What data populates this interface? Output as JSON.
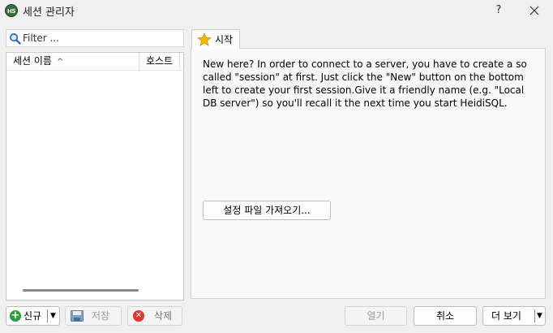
{
  "window": {
    "app_icon_text": "HS",
    "title": "세션 관리자",
    "help_label": "?"
  },
  "filter": {
    "placeholder": "Filter ..."
  },
  "session_list": {
    "columns": [
      "세션 이름",
      "호스트"
    ],
    "sort_indicator": "^",
    "sessions": []
  },
  "tabs": [
    {
      "label": "시작",
      "icon": "star-icon",
      "active": true
    }
  ],
  "start_panel": {
    "intro": "New here? In order to connect to a server, you have to create a so called \"session\" at first. Just click the \"New\" button on the bottom left to create your first session.Give it a friendly name (e.g. \"Local DB server\") so you'll recall it the next time you start HeidiSQL.",
    "import_button": "설정 파일 가져오기..."
  },
  "buttons": {
    "new": "신규",
    "save": "저장",
    "delete": "삭제",
    "open": "열기",
    "cancel": "취소",
    "more": "더 보기"
  },
  "colors": {
    "accent_green": "#2e9e3e",
    "delete_red": "#e03434",
    "star_yellow": "#f5b800"
  }
}
